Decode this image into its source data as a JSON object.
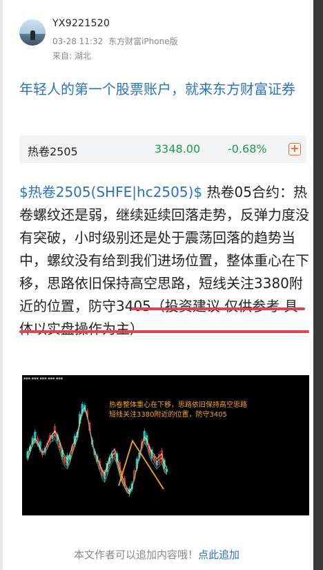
{
  "post": {
    "author": {
      "username": "YX9221520",
      "datetime": "03-28 11:32",
      "source": "东方财富iPhone版",
      "location": "来自: 湖北"
    },
    "promo_text": "年轻人的第一个股票账户，就来东方财富证券",
    "stock": {
      "name": "热卷2505",
      "price": "3348.00",
      "change": "-0.68%",
      "add_icon": "plus-square-icon"
    },
    "body": {
      "tag": "$热卷2505(SHFE|hc2505)$",
      "text": " 热卷05合约：热卷螺纹还是弱，继续延续回落走势，反弹力度没有突破，小时级别还是处于震荡回落的趋势当中，螺纹没有给到我们进场位置，整体重心在下移，思路依旧保持高空思路，短线关注3380附近的位置，防守3405（投资建议 仅供参考 具体以实盘操作为主）"
    },
    "chart_image": {
      "note_line1": "热卷整体重心在下移，思路依旧保持高空思路",
      "note_line2": "短线关注3380附近的位置，防守3405"
    },
    "footer": {
      "hint": "本文作者可以追加内容哦！",
      "link": "点此追加"
    }
  },
  "colors": {
    "accent_blue": "#2a72c2",
    "down_green": "#1e9a4f",
    "highlight_red": "#e2434f",
    "annotation_orange": "#f5a623"
  }
}
